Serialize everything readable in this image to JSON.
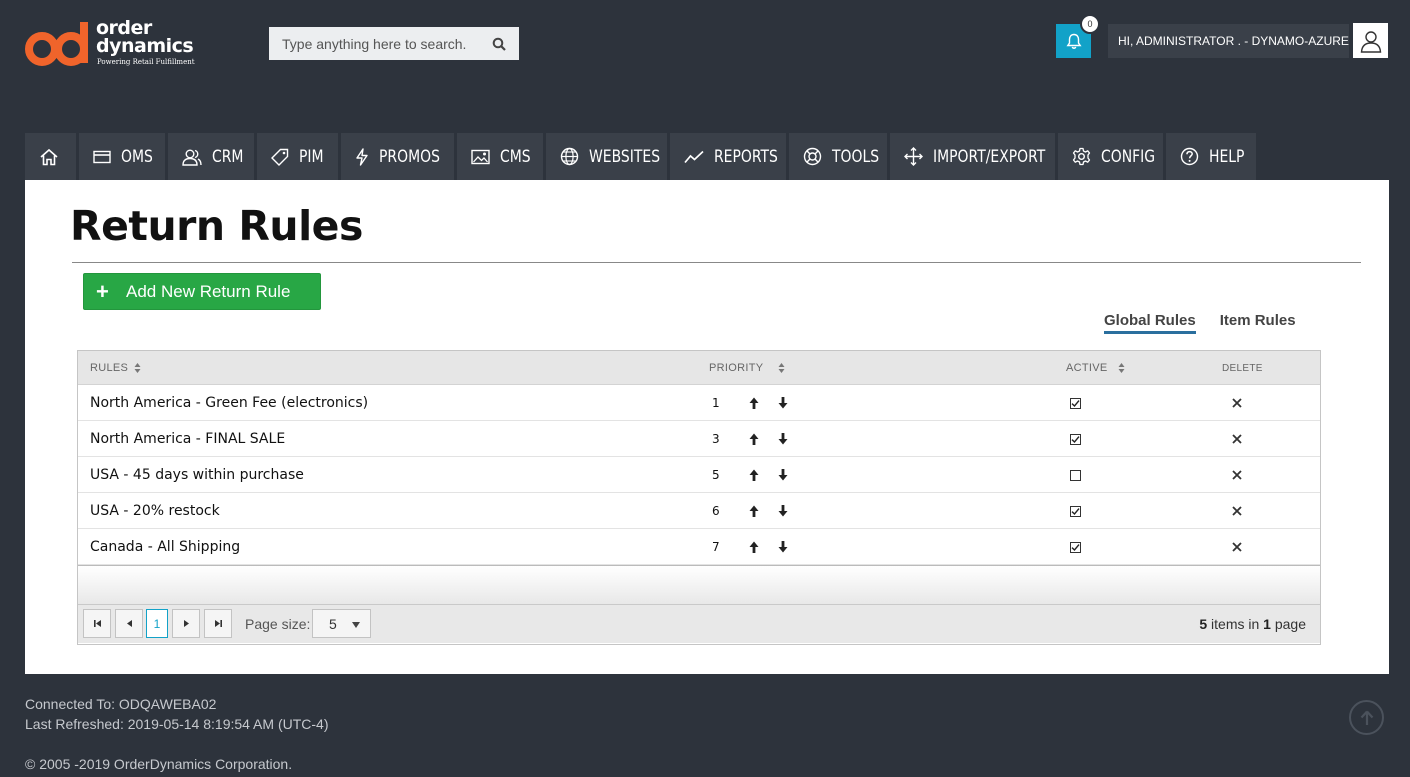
{
  "brand": {
    "line1": "order",
    "line2": "dynamics",
    "tagline": "Powering Retail Fulfillment",
    "primary_color": "#f0642b"
  },
  "search": {
    "placeholder": "Type anything here to search."
  },
  "notifications": {
    "count": "0"
  },
  "user": {
    "greeting": "HI, ADMINISTRATOR . - DYNAMO-AZURE"
  },
  "nav": {
    "items": [
      {
        "label": "",
        "icon": "home-icon"
      },
      {
        "label": "OMS",
        "icon": "credit-card-icon"
      },
      {
        "label": "CRM",
        "icon": "users-icon"
      },
      {
        "label": "PIM",
        "icon": "tag-icon"
      },
      {
        "label": "PROMOS",
        "icon": "bolt-icon"
      },
      {
        "label": "CMS",
        "icon": "image-icon"
      },
      {
        "label": "WEBSITES",
        "icon": "globe-icon"
      },
      {
        "label": "REPORTS",
        "icon": "chart-line-icon"
      },
      {
        "label": "TOOLS",
        "icon": "lifebuoy-icon"
      },
      {
        "label": "IMPORT/EXPORT",
        "icon": "move-icon"
      },
      {
        "label": "CONFIG",
        "icon": "gear-icon"
      },
      {
        "label": "HELP",
        "icon": "question-icon"
      }
    ]
  },
  "page": {
    "title": "Return Rules",
    "add_button": "Add New Return Rule",
    "tabs": [
      {
        "label": "Global Rules",
        "active": true
      },
      {
        "label": "Item Rules",
        "active": false
      }
    ]
  },
  "grid": {
    "columns": {
      "rules": "RULES",
      "priority": "PRIORITY",
      "active": "ACTIVE",
      "delete": "DELETE"
    },
    "rows": [
      {
        "name": "North America - Green Fee (electronics)",
        "priority": "1",
        "active": true
      },
      {
        "name": "North America - FINAL SALE",
        "priority": "3",
        "active": true
      },
      {
        "name": "USA - 45 days within purchase",
        "priority": "5",
        "active": false
      },
      {
        "name": "USA - 20% restock",
        "priority": "6",
        "active": true
      },
      {
        "name": "Canada - All Shipping",
        "priority": "7",
        "active": true
      }
    ],
    "pager": {
      "current_page": "1",
      "page_size_label": "Page size:",
      "page_size": "5",
      "total_items": "5",
      "items_in": "items in",
      "total_pages": "1",
      "page_word": "page"
    }
  },
  "footer": {
    "connected": "Connected To: ODQAWEBA02",
    "refreshed": "Last Refreshed: 2019-05-14 8:19:54 AM (UTC-4)",
    "copyright": "© 2005 -2019 OrderDynamics Corporation."
  }
}
